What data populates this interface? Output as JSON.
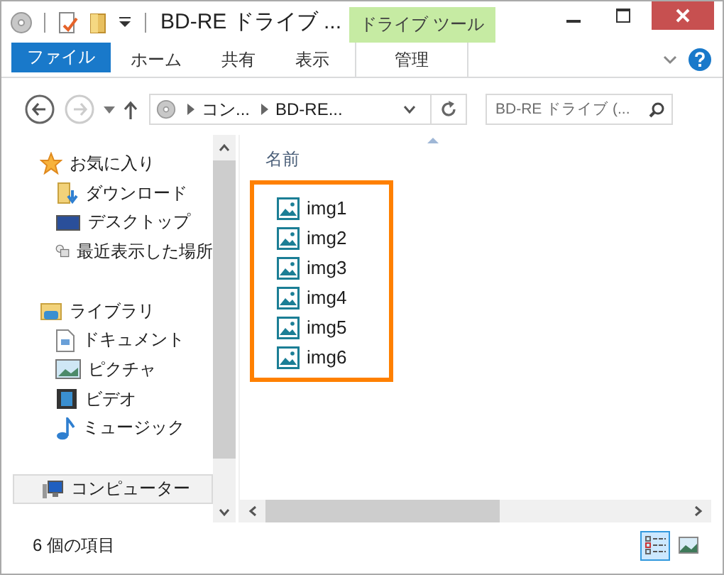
{
  "window": {
    "title": "BD-RE ドライブ ...",
    "contextual_tab": "ドライブ ツール"
  },
  "ribbon_tabs": [
    {
      "label": "ファイル",
      "kind": "file"
    },
    {
      "label": "ホーム",
      "kind": "tab"
    },
    {
      "label": "共有",
      "kind": "tab"
    },
    {
      "label": "表示",
      "kind": "tab"
    },
    {
      "label": "管理",
      "kind": "contextual"
    }
  ],
  "address": {
    "crumbs": [
      "コン...",
      "BD-RE..."
    ]
  },
  "search": {
    "placeholder": "BD-RE ドライブ (..."
  },
  "navigation": [
    {
      "label": "お気に入り",
      "selected": false,
      "children": [
        {
          "label": "ダウンロード",
          "selected": false
        },
        {
          "label": "デスクトップ",
          "selected": false
        },
        {
          "label": "最近表示した場所",
          "selected": false
        }
      ]
    },
    {
      "label": "ライブラリ",
      "selected": false,
      "children": [
        {
          "label": "ドキュメント",
          "selected": false
        },
        {
          "label": "ピクチャ",
          "selected": false
        },
        {
          "label": "ビデオ",
          "selected": false
        },
        {
          "label": "ミュージック",
          "selected": false
        }
      ]
    },
    {
      "label": "コンピューター",
      "selected": true
    }
  ],
  "file_list": {
    "column": "名前",
    "outlined": true,
    "files": [
      {
        "name": "img1"
      },
      {
        "name": "img2"
      },
      {
        "name": "img3"
      },
      {
        "name": "img4"
      },
      {
        "name": "img5"
      },
      {
        "name": "img6"
      }
    ]
  },
  "status_bar": {
    "text": "6 個の項目",
    "views": [
      {
        "kind": "details",
        "selected": true
      },
      {
        "kind": "large",
        "selected": false
      }
    ]
  }
}
